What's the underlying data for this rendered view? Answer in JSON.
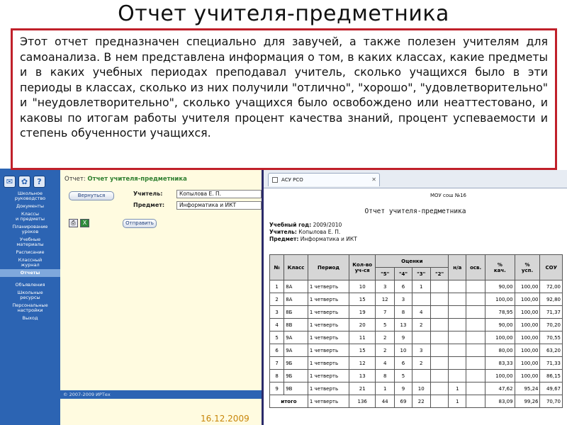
{
  "slide": {
    "title": "Отчет учителя-предметника",
    "description": "Этот отчет предназначен специально для завучей, а также полезен учителям для самоанализа. В нем представлена информация о том, в каких классах, какие предметы и в каких учебных периодах преподавал учитель, сколько учащихся было в эти периоды в классах, сколько из них получили \"отлично\", \"хорошо\", \"удовлетворительно\" и \"неудовлетворительно\", сколько учащихся было освобождено или неаттестовано, и каковы по итогам работы учителя процент качества знаний, процент успеваемости и степень обученности учащихся.",
    "footer_date": "16.12.2009",
    "accent_color": "#c0202a"
  },
  "app": {
    "side_icons": [
      "mail-icon",
      "flower-icon",
      "help-icon"
    ],
    "side_icon_glyphs": [
      "✉",
      "✿",
      "?"
    ],
    "menu": [
      {
        "label": "Школьное\nруководство",
        "active": false
      },
      {
        "label": "Документы",
        "active": false
      },
      {
        "label": "Классы\nи предметы",
        "active": false
      },
      {
        "label": "Планирование\nуроков",
        "active": false
      },
      {
        "label": "Учебные\nматериалы",
        "active": false
      },
      {
        "label": "Расписание",
        "active": false
      },
      {
        "label": "Классный\nжурнал",
        "active": false
      },
      {
        "label": "Отчеты",
        "active": true
      },
      {
        "label": "Объявления",
        "active": false
      },
      {
        "label": "Школьные\nресурсы",
        "active": false
      },
      {
        "label": "Персональные\nнастройки",
        "active": false
      },
      {
        "label": "Выход",
        "active": false
      }
    ],
    "report_prefix": "Отчет:",
    "report_name": "Отчет учителя-предметника",
    "back_button": "Вернуться",
    "teacher_label": "Учитель:",
    "teacher_value": "Копылова Е. П.",
    "subject_label": "Предмет:",
    "subject_value": "Информатика и ИКТ",
    "send_button": "Отправить",
    "copyright": "© 2007-2009 ИРТех",
    "brand_color": "#2c64b3"
  },
  "report": {
    "tab_title": "АСУ РСО",
    "school": "МОУ сош №16",
    "title": "Отчет учителя-предметника",
    "year_label": "Учебный год:",
    "year_value": "2009/2010",
    "teacher_label": "Учитель:",
    "teacher_value": "Копылова Е. П.",
    "subject_label": "Предмет:",
    "subject_value": "Информатика и ИКТ",
    "columns": {
      "no": "№",
      "class": "Класс",
      "period": "Период",
      "count": "Кол-во\nуч-ся",
      "grades": "Оценки",
      "g5": "\"5\"",
      "g4": "\"4\"",
      "g3": "\"3\"",
      "g2": "\"2\"",
      "na": "н/а",
      "exempt": "осв.",
      "quality": "%\nкач.",
      "success": "%\nусп.",
      "sou": "СОУ"
    },
    "rows": [
      [
        "1",
        "8А",
        "1 четверть",
        "10",
        "3",
        "6",
        "1",
        "",
        "",
        "",
        "90,00",
        "100,00",
        "72,00"
      ],
      [
        "2",
        "8А",
        "1 четверть",
        "15",
        "12",
        "3",
        "",
        "",
        "",
        "",
        "100,00",
        "100,00",
        "92,80"
      ],
      [
        "3",
        "8Б",
        "1 четверть",
        "19",
        "7",
        "8",
        "4",
        "",
        "",
        "",
        "78,95",
        "100,00",
        "71,37"
      ],
      [
        "4",
        "8В",
        "1 четверть",
        "20",
        "5",
        "13",
        "2",
        "",
        "",
        "",
        "90,00",
        "100,00",
        "70,20"
      ],
      [
        "5",
        "9А",
        "1 четверть",
        "11",
        "2",
        "9",
        "",
        "",
        "",
        "",
        "100,00",
        "100,00",
        "70,55"
      ],
      [
        "6",
        "9А",
        "1 четверть",
        "15",
        "2",
        "10",
        "3",
        "",
        "",
        "",
        "80,00",
        "100,00",
        "63,20"
      ],
      [
        "7",
        "9Б",
        "1 четверть",
        "12",
        "4",
        "6",
        "2",
        "",
        "",
        "",
        "83,33",
        "100,00",
        "71,33"
      ],
      [
        "8",
        "9Б",
        "1 четверть",
        "13",
        "8",
        "5",
        "",
        "",
        "",
        "",
        "100,00",
        "100,00",
        "86,15"
      ],
      [
        "9",
        "9В",
        "1 четверть",
        "21",
        "1",
        "9",
        "10",
        "",
        "1",
        "",
        "47,62",
        "95,24",
        "49,67"
      ]
    ],
    "total": [
      "итого",
      "1 четверть",
      "136",
      "44",
      "69",
      "22",
      "",
      "1",
      "",
      "83,09",
      "99,26",
      "70,70"
    ]
  }
}
